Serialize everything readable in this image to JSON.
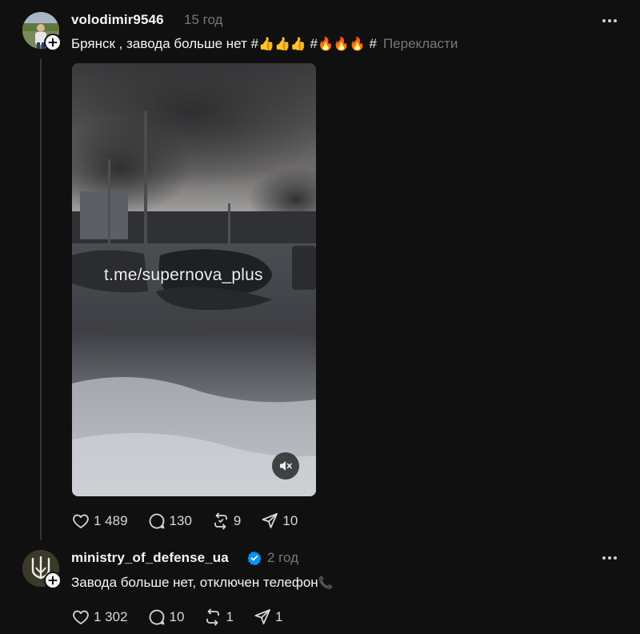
{
  "post1": {
    "username": "volodimir9546",
    "time": "15 год",
    "text_prefix": "Брянск , завода больше нет #",
    "emoji_thumbs": "👍👍👍",
    "text_mid": " #",
    "emoji_fire": "🔥🔥🔥",
    "text_suffix": " #",
    "translate_label": "Перекласти",
    "media": {
      "watermark": "t.me/supernova_plus",
      "mute_icon": "speaker-muted-icon"
    },
    "actions": {
      "likes": "1 489",
      "replies": "130",
      "reposts": "9",
      "shares": "10"
    }
  },
  "post2": {
    "username": "ministry_of_defense_ua",
    "verified": true,
    "time": "2 год",
    "text": "Завода больше нет, отключен телефон",
    "phone_emoji": "📞",
    "actions": {
      "likes": "1 302",
      "replies": "10",
      "reposts": "1",
      "shares": "1"
    }
  },
  "colors": {
    "background": "#101010",
    "text": "#f3f5f7",
    "muted": "#777777",
    "verified": "#0095f6"
  },
  "icons": [
    "heart-icon",
    "comment-icon",
    "repost-icon",
    "share-icon",
    "more-icon",
    "plus-icon",
    "verified-icon"
  ]
}
